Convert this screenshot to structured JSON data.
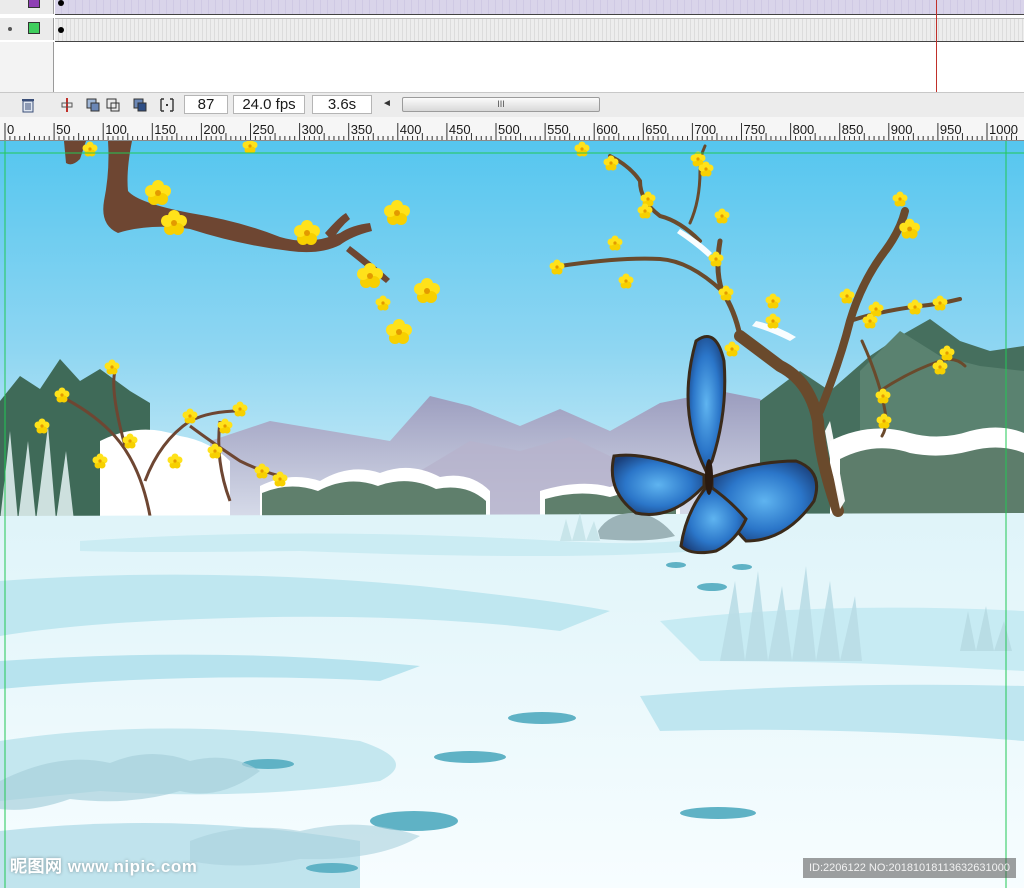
{
  "timeline": {
    "layers": [
      {
        "name": "purple-layer",
        "color": "#8e3fb4"
      },
      {
        "name": "green-layer",
        "color": "#3fce5d"
      }
    ],
    "current_frame": "87",
    "frame_rate": "24.0 fps",
    "elapsed_time": "3.6s",
    "scroll_thumb_glyph": "III",
    "scroll_left_glyph": "◄"
  },
  "ruler": {
    "ticks": [
      "0",
      "50",
      "100",
      "150",
      "200",
      "250",
      "300",
      "350",
      "400",
      "450",
      "500",
      "550",
      "600",
      "650",
      "700",
      "750",
      "800",
      "850",
      "900",
      "950",
      "1000"
    ]
  },
  "stage": {
    "scene": "winter plum blossom landscape with blue butterfly",
    "colors": {
      "sky_top": "#55c6ef",
      "sky_bottom": "#bfe6f2",
      "snow": "#f4fcfe",
      "snow_shadow": "#bfe7f0",
      "blossom": "#ffe21a",
      "branch": "#6e4632",
      "butterfly": "#2f7fd1",
      "guide": "#22c855"
    }
  },
  "watermark": {
    "left": "昵图网 www.nipic.com",
    "right": "ID:2206122 NO:20181018113632631000"
  }
}
